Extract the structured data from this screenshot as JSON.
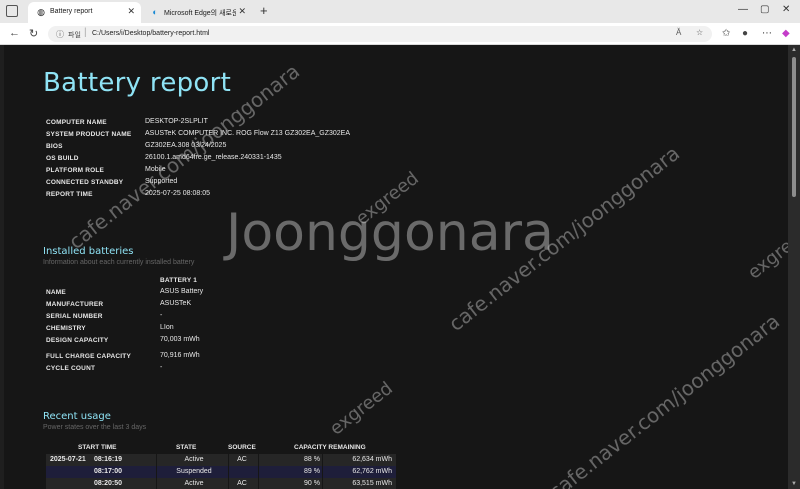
{
  "browser": {
    "tabs": [
      {
        "title": "Battery report",
        "favicon": "globe-icon"
      },
      {
        "title": "Microsoft Edge의 새로운 기능",
        "favicon": "edge-icon"
      }
    ],
    "address": {
      "scheme_label": "파일",
      "url": "C:/Users/i/Desktop/battery-report.html",
      "reader_label": "Ă"
    }
  },
  "report": {
    "title": "Battery report",
    "system_info": [
      {
        "key": "COMPUTER NAME",
        "value": "DESKTOP-2SLPLIT"
      },
      {
        "key": "SYSTEM PRODUCT NAME",
        "value": "ASUSTeK COMPUTER INC. ROG Flow Z13 GZ302EA_GZ302EA"
      },
      {
        "key": "BIOS",
        "value": "GZ302EA.308 03/24/2025"
      },
      {
        "key": "OS BUILD",
        "value": "26100.1.amd64fre.ge_release.240331-1435"
      },
      {
        "key": "PLATFORM ROLE",
        "value": "Mobile"
      },
      {
        "key": "CONNECTED STANDBY",
        "value": "Supported"
      },
      {
        "key": "REPORT TIME",
        "value": "2025-07-25  08:08:05"
      }
    ],
    "installed_batteries": {
      "heading": "Installed batteries",
      "subtitle": "Information about each currently installed battery",
      "column": "BATTERY 1",
      "rows": [
        {
          "key": "NAME",
          "value": "ASUS Battery"
        },
        {
          "key": "MANUFACTURER",
          "value": "ASUSTeK"
        },
        {
          "key": "SERIAL NUMBER",
          "value": "-"
        },
        {
          "key": "CHEMISTRY",
          "value": "LIon"
        },
        {
          "key": "DESIGN CAPACITY",
          "value": "70,003 mWh"
        },
        {
          "key": "FULL CHARGE CAPACITY",
          "value": "70,916 mWh"
        },
        {
          "key": "CYCLE COUNT",
          "value": "-"
        }
      ]
    },
    "recent_usage": {
      "heading": "Recent usage",
      "subtitle": "Power states over the last 3 days",
      "headers": {
        "start_time": "START TIME",
        "state": "STATE",
        "source": "SOURCE",
        "capacity": "CAPACITY REMAINING"
      },
      "rows": [
        {
          "date": "2025-07-21",
          "time": "08:16:19",
          "state": "Active",
          "source": "AC",
          "percent": "88 %",
          "mwh": "62,634 mWh"
        },
        {
          "date": "",
          "time": "08:17:00",
          "state": "Suspended",
          "source": "",
          "percent": "89 %",
          "mwh": "62,762 mWh"
        },
        {
          "date": "",
          "time": "08:20:50",
          "state": "Active",
          "source": "AC",
          "percent": "90 %",
          "mwh": "63,515 mWh"
        }
      ]
    }
  },
  "watermarks": {
    "brand": "Joonggonara",
    "url": "cafe.naver.com/joonggonara",
    "user": "exgreed"
  },
  "colors": {
    "accent": "#8fe3f5",
    "page_bg": "#161616"
  }
}
